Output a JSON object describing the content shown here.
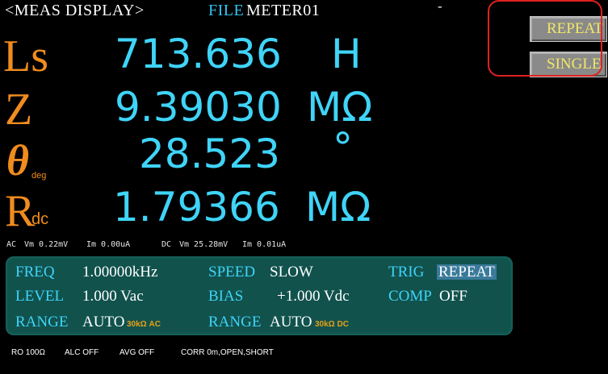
{
  "header": {
    "screen_title": "<MEAS DISPLAY>",
    "file_label": "FILE",
    "file_name": "METER01",
    "status": "-"
  },
  "measurements": [
    {
      "param": "Ls",
      "param_sub": "",
      "value": "713.636",
      "unit": "H"
    },
    {
      "param": "Z",
      "param_sub": "",
      "value": "9.39030",
      "unit": "MΩ"
    },
    {
      "param": "θ",
      "param_sub": "deg",
      "value": "28.523",
      "unit": "°"
    },
    {
      "param": "R",
      "param_sub": "dc",
      "value": "1.79366",
      "unit": "MΩ"
    }
  ],
  "monitor": {
    "ac_label": "AC",
    "ac_vm": "Vm 0.22mV",
    "ac_im": "Im 0.00uA",
    "dc_label": "DC",
    "dc_vm": "Vm 25.28mV",
    "dc_im": "Im 0.01uA"
  },
  "settings": {
    "freq_label": "FREQ",
    "freq_value": "1.00000kHz",
    "speed_label": "SPEED",
    "speed_value": "SLOW",
    "trig_label": "TRIG",
    "trig_value": "REPEAT",
    "level_label": "LEVEL",
    "level_value": "1.000 Vac",
    "bias_label": "BIAS",
    "bias_value": "+1.000 Vdc",
    "comp_label": "COMP",
    "comp_value": "OFF",
    "range_ac_label": "RANGE",
    "range_ac_value": "AUTO",
    "range_ac_detail": "30kΩ AC",
    "range_dc_label": "RANGE",
    "range_dc_value": "AUTO",
    "range_dc_detail": "30kΩ DC"
  },
  "footer": {
    "ro": "RO 100Ω",
    "alc": "ALC OFF",
    "avg": "AVG OFF",
    "corr": "CORR 0m,OPEN,SHORT"
  },
  "softkeys": {
    "repeat_label": "REPEAT",
    "single_label": "SINGLE"
  },
  "colors": {
    "background": "#000000",
    "value_cyan": "#3fd4f8",
    "param_orange": "#f08c1e",
    "panel_teal": "#11524d",
    "softkey_text": "#f2e766",
    "highlight_red": "#e02020"
  }
}
